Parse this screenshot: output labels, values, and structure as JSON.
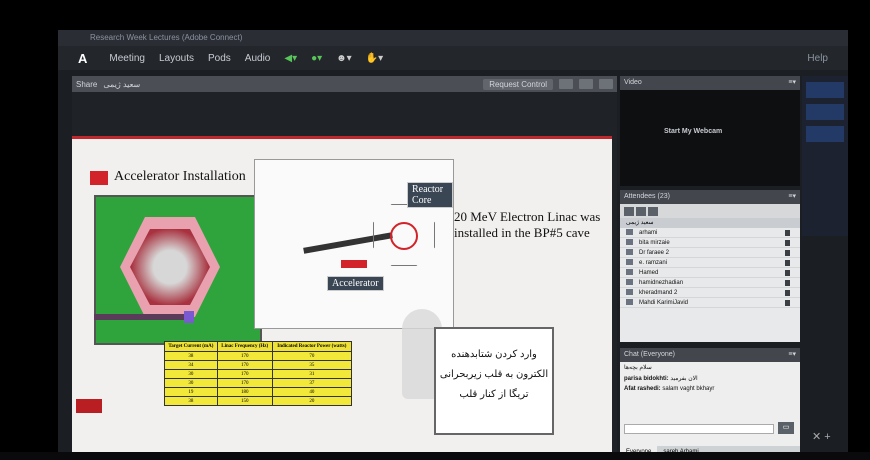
{
  "window": {
    "title": "Research Week Lectures (Adobe Connect)"
  },
  "menu": {
    "logo": "A",
    "items": [
      "Meeting",
      "Layouts",
      "Pods",
      "Audio"
    ],
    "help": "Help"
  },
  "share": {
    "title": "Share",
    "presenter": "سعید ژیمی",
    "request_control": "Request Control"
  },
  "slide": {
    "title": "Accelerator Installation",
    "reactor_core_label": "Reactor Core",
    "accelerator_label": "Accelerator",
    "linac_text": "20 MeV Electron Linac was installed in the BP#5 cave",
    "note_text": "وارد کردن شتابدهنده الکترون به قلب زیربحرانی تریگا از کنار قلب",
    "table": {
      "headers": [
        "Target Current (mA)",
        "Linac Frequency (Hz)",
        "Indicated Reactor Power (watts)"
      ],
      "rows": [
        [
          "38",
          "170",
          "70"
        ],
        [
          "34",
          "170",
          "35"
        ],
        [
          "30",
          "170",
          "31"
        ],
        [
          "30",
          "170",
          "37"
        ],
        [
          "19",
          "180",
          "40"
        ],
        [
          "38",
          "150",
          "20"
        ]
      ]
    }
  },
  "video": {
    "title": "Video",
    "webcam_button": "Start My Webcam"
  },
  "attendees": {
    "title": "Attendees",
    "count": "(23)",
    "host": "سعید ژیمی",
    "list": [
      "arhami",
      "bita mirzaie",
      "Dr faraee 2",
      "e. ramzani",
      "Hamed",
      "hamidnezhadian",
      "kheradmand 2",
      "Mahdi KarimiJavid"
    ]
  },
  "chat": {
    "title": "Chat",
    "scope": "(Everyone)",
    "messages": [
      {
        "from": "",
        "text": "سلام بچه‌ها"
      },
      {
        "from": "parisa bidokhti:",
        "text": "الان بفرمید"
      },
      {
        "from": "Afat rashedi:",
        "text": "salam vaght bkhayr"
      }
    ],
    "tabs": [
      "Everyone",
      "sareh Arhami"
    ]
  }
}
